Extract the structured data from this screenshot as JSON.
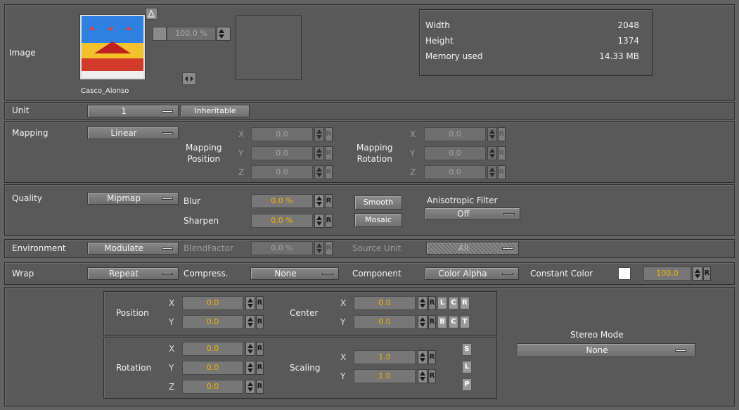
{
  "image": {
    "label": "Image",
    "thumb_name": "Casco_Alonso",
    "zoom": "100.0 %",
    "info": {
      "width_label": "Width",
      "width_value": "2048",
      "height_label": "Height",
      "height_value": "1374",
      "memory_label": "Memory used",
      "memory_value": "14.33 MB"
    }
  },
  "unit": {
    "label": "Unit",
    "value": "1",
    "inheritable": "Inheritable"
  },
  "mapping": {
    "label": "Mapping",
    "value": "Linear",
    "position_label_1": "Mapping",
    "position_label_2": "Position",
    "rotation_label_1": "Mapping",
    "rotation_label_2": "Rotation",
    "axes": [
      "X",
      "Y",
      "Z"
    ],
    "position": [
      "0.0",
      "0.0",
      "0.0"
    ],
    "rotation": [
      "0.0",
      "0.0",
      "0.0"
    ],
    "r": "R"
  },
  "quality": {
    "label": "Quality",
    "value": "Mipmap",
    "blur_label": "Blur",
    "blur_value": "0.0 %",
    "sharpen_label": "Sharpen",
    "sharpen_value": "0.0 %",
    "smooth": "Smooth",
    "mosaic": "Mosaic",
    "aniso_label": "Anisotropic Filter",
    "aniso_value": "Off"
  },
  "environment": {
    "label": "Environment",
    "value": "Modulate",
    "blend_label": "BlendFactor",
    "blend_value": "0.0 %",
    "source_label": "Source Unit",
    "source_value": "All"
  },
  "wrap": {
    "label": "Wrap",
    "value": "Repeat",
    "compress_label": "Compress.",
    "compress_value": "None",
    "component_label": "Component",
    "component_value": "Color Alpha",
    "constant_label": "Constant Color",
    "constant_value": "100.0",
    "constant_color": "#ffffff"
  },
  "transform": {
    "position_label": "Position",
    "position": [
      "0.0",
      "0.0"
    ],
    "center_label": "Center",
    "center": [
      "0.0",
      "0.0"
    ],
    "rotation_label": "Rotation",
    "rotation": [
      "0.0",
      "0.0",
      "0.0"
    ],
    "scaling_label": "Scaling",
    "scaling": [
      "1.0",
      "1.0"
    ],
    "align_h": [
      "L",
      "C",
      "R"
    ],
    "align_v": [
      "B",
      "C",
      "T"
    ],
    "scale_btns": [
      "S",
      "L",
      "P"
    ]
  },
  "stereo": {
    "label": "Stereo Mode",
    "value": "None"
  },
  "colors": {
    "background": "#636363",
    "panel": "#595959",
    "active_value": "#f2b400"
  }
}
